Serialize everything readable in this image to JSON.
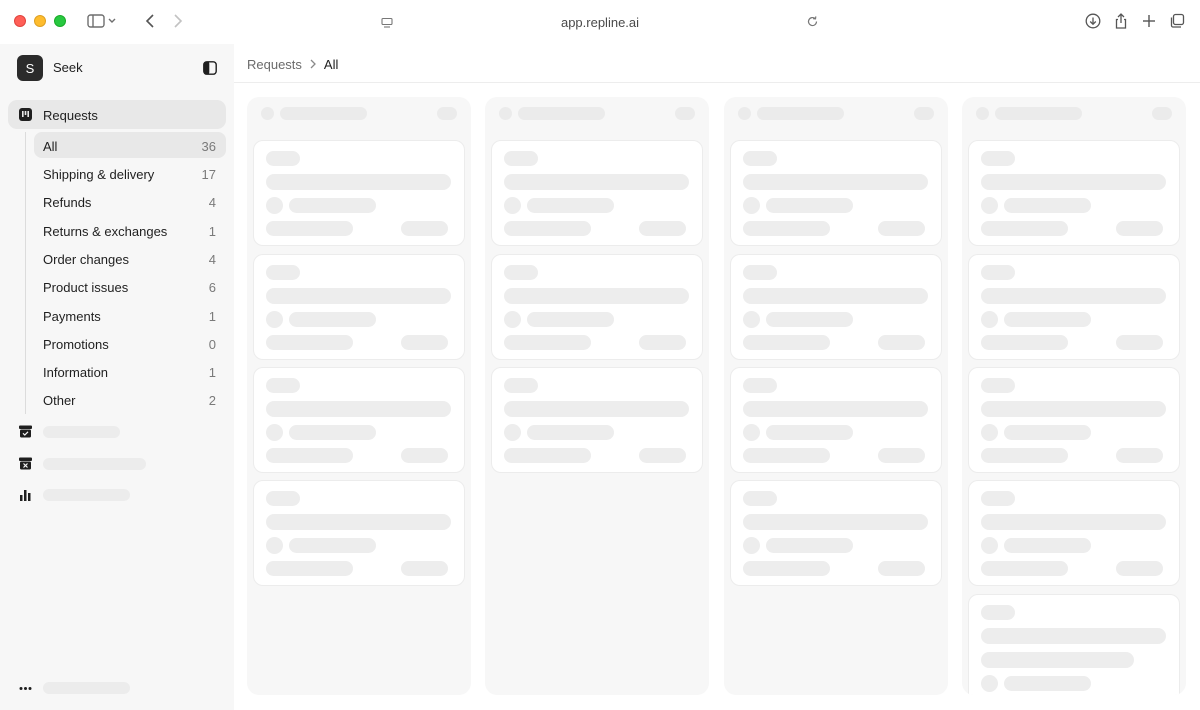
{
  "browser": {
    "url": "app.repline.ai"
  },
  "workspace": {
    "initial": "S",
    "name": "Seek"
  },
  "nav": {
    "requests_label": "Requests",
    "categories": [
      {
        "label": "All",
        "count": "36",
        "active": true
      },
      {
        "label": "Shipping & delivery",
        "count": "17"
      },
      {
        "label": "Refunds",
        "count": "4"
      },
      {
        "label": "Returns & exchanges",
        "count": "1"
      },
      {
        "label": "Order changes",
        "count": "4"
      },
      {
        "label": "Product issues",
        "count": "6"
      },
      {
        "label": "Payments",
        "count": "1"
      },
      {
        "label": "Promotions",
        "count": "0"
      },
      {
        "label": "Information",
        "count": "1"
      },
      {
        "label": "Other",
        "count": "2"
      }
    ],
    "loading_items": [
      "archive-check-icon",
      "archive-x-icon",
      "bar-chart-icon",
      "more-dots-icon"
    ]
  },
  "breadcrumb": {
    "parent": "Requests",
    "current": "All"
  },
  "board": {
    "state": "loading",
    "columns": [
      {
        "placeholder_cards": 4
      },
      {
        "placeholder_cards": 3
      },
      {
        "placeholder_cards": 4
      },
      {
        "placeholder_cards": 5
      }
    ]
  },
  "colors": {
    "sidebar_bg": "#f7f7f7",
    "active_bg": "#e8e8e8",
    "skeleton": "#ececec",
    "traffic_red": "#ff5f57",
    "traffic_yellow": "#febc2e",
    "traffic_green": "#28c840"
  }
}
